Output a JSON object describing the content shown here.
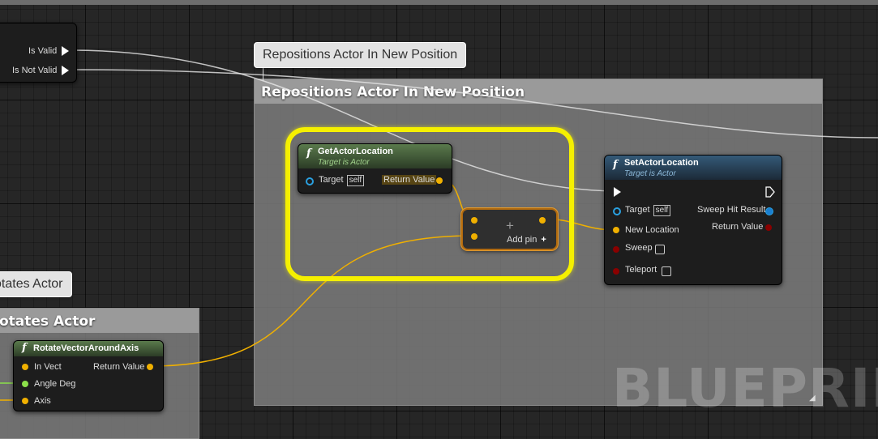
{
  "colors": {
    "highlight": "#f5f000",
    "vector_pin": "#f0b000",
    "float_pin": "#8ce04a",
    "object_pin": "#2aa0e0",
    "bool_pin": "#8a0000",
    "function_header": "#4a6a3c",
    "target_header": "#2a4a68"
  },
  "left_node": {
    "is_valid": "Is Valid",
    "is_not_valid": "Is Not Valid"
  },
  "comments": {
    "reposition_bubble": "Repositions Actor In New Position",
    "reposition_header": "Repositions Actor In New Position",
    "rotate_bubble": "otates Actor",
    "rotate_header": "otates Actor"
  },
  "get_actor_location": {
    "icon": "function-icon",
    "title": "GetActorLocation",
    "subtitle": "Target is Actor",
    "target": "Target",
    "self": "self",
    "return_value": "Return Value"
  },
  "add_node": {
    "symbol": "+",
    "add_pin": "Add pin"
  },
  "set_actor_location": {
    "icon": "function-icon",
    "title": "SetActorLocation",
    "subtitle": "Target is Actor",
    "target": "Target",
    "self": "self",
    "new_location": "New Location",
    "sweep": "Sweep",
    "teleport": "Teleport",
    "sweep_hit_result": "Sweep Hit Result",
    "return_value": "Return Value"
  },
  "rotate_vector": {
    "icon": "function-icon",
    "title": "RotateVectorAroundAxis",
    "in_vect": "In Vect",
    "angle_deg": "Angle Deg",
    "axis": "Axis",
    "return_value": "Return Value"
  },
  "watermark": "BLUEPRINT"
}
